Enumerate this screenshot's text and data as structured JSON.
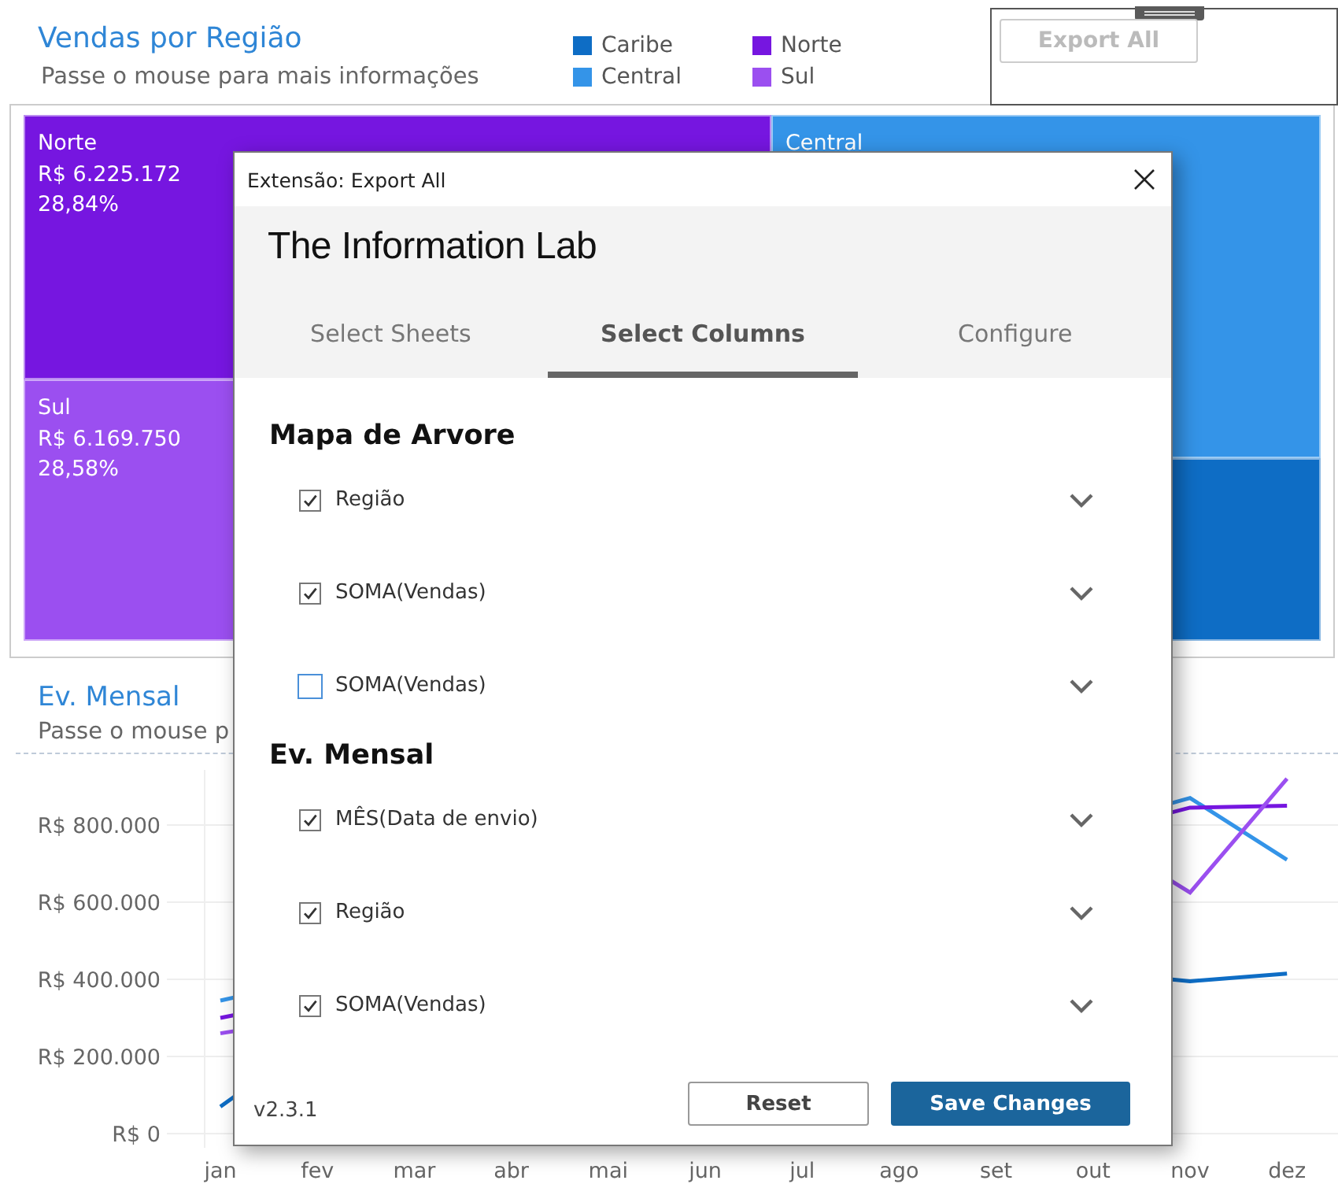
{
  "dashboard": {
    "title": "Vendas por Região",
    "subtitle": "Passe o mouse para mais informações",
    "export_button": {
      "label": "Export All",
      "disabled": true
    },
    "treemap": [
      {
        "name": "Norte",
        "value": "R$ 6.225.172",
        "share": "28,84%",
        "color": "#7616e0"
      },
      {
        "name": "Sul",
        "value": "R$ 6.169.750",
        "share": "28,58%",
        "color": "#9b4ff0"
      },
      {
        "name": "Central",
        "color": "#3494e8"
      },
      {
        "color": "#0e6dc5"
      }
    ],
    "line_section": {
      "title": "Ev. Mensal",
      "subtitle": "Passe o mouse p",
      "x_labels": [
        "jan",
        "fev",
        "mar",
        "abr",
        "mai",
        "jun",
        "jul",
        "ago",
        "set",
        "out",
        "nov",
        "dez"
      ],
      "y_labels": [
        "R$ 800.000",
        "R$ 600.000",
        "R$ 400.000",
        "R$ 200.000",
        "R$ 0"
      ],
      "series": [
        {
          "name": "Caribe",
          "color": "#0e6dc5"
        },
        {
          "name": "Central",
          "color": "#3494e8"
        },
        {
          "name": "Norte",
          "color": "#7616e0"
        },
        {
          "name": "Sul",
          "color": "#9b4ff0"
        }
      ]
    }
  },
  "dialog": {
    "title": "Extensão: Export All",
    "brand": "The Information Lab",
    "tabs": [
      {
        "label": "Select Sheets",
        "selected": false
      },
      {
        "label": "Select Columns",
        "selected": true
      },
      {
        "label": "Configure",
        "selected": false
      }
    ],
    "sections": [
      {
        "heading": "Mapa de Arvore",
        "columns": [
          {
            "label": "Região",
            "checked": true
          },
          {
            "label": "SOMA(Vendas)",
            "checked": true
          },
          {
            "label": "SOMA(Vendas)",
            "checked": false
          }
        ]
      },
      {
        "heading": "Ev. Mensal",
        "columns": [
          {
            "label": "MÊS(Data de envio)",
            "checked": true
          },
          {
            "label": "Região",
            "checked": true
          },
          {
            "label": "SOMA(Vendas)",
            "checked": true
          }
        ]
      }
    ],
    "version": "v2.3.1",
    "reset_button": "Reset",
    "save_button": "Save Changes"
  }
}
